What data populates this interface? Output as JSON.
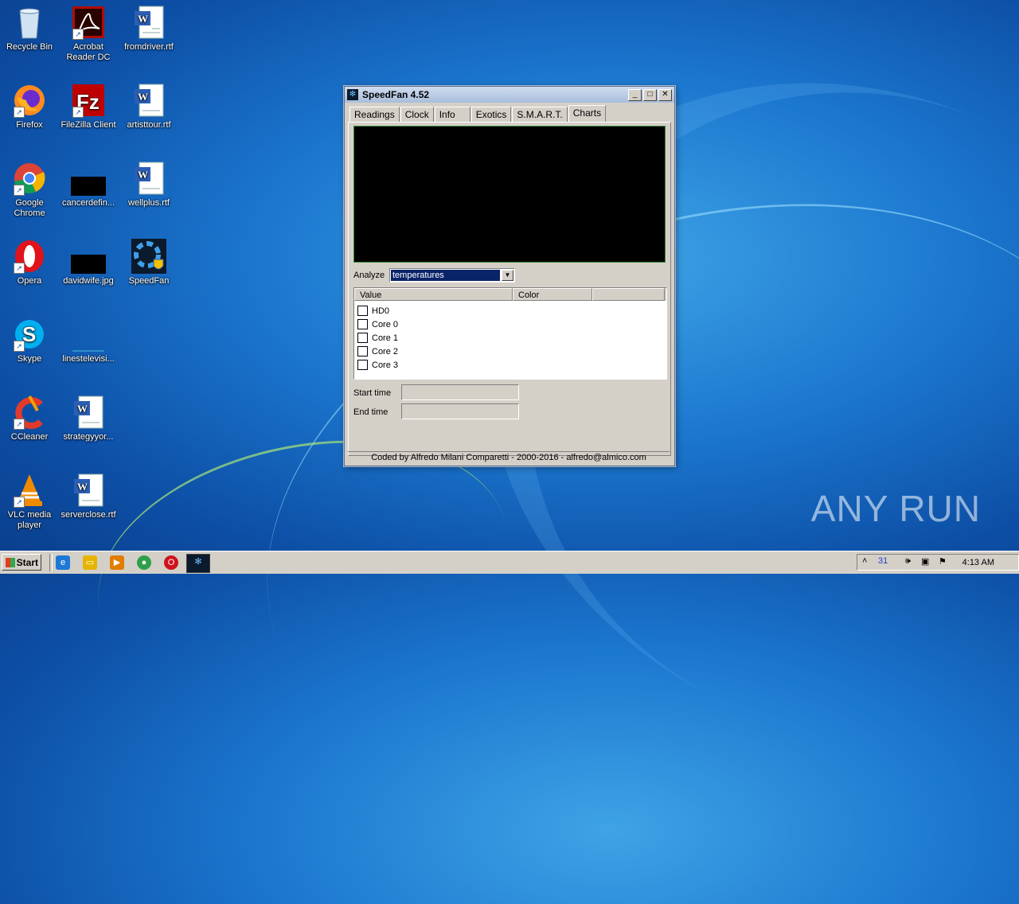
{
  "desktop": {
    "icons": [
      {
        "label": "Recycle Bin",
        "icon": "recycle-bin-icon"
      },
      {
        "label": "Acrobat Reader DC",
        "icon": "acrobat-icon"
      },
      {
        "label": "fromdriver.rtf",
        "icon": "word-document-icon"
      },
      {
        "label": "Firefox",
        "icon": "firefox-icon"
      },
      {
        "label": "FileZilla Client",
        "icon": "filezilla-icon"
      },
      {
        "label": "artisttour.rtf",
        "icon": "word-document-icon"
      },
      {
        "label": "Google Chrome",
        "icon": "chrome-icon"
      },
      {
        "label": "cancerdefin...",
        "icon": "black-thumbnail-icon"
      },
      {
        "label": "wellplus.rtf",
        "icon": "word-document-icon"
      },
      {
        "label": "Opera",
        "icon": "opera-icon"
      },
      {
        "label": "davidwife.jpg",
        "icon": "black-thumbnail-icon"
      },
      {
        "label": "SpeedFan",
        "icon": "speedfan-icon"
      },
      {
        "label": "Skype",
        "icon": "skype-icon"
      },
      {
        "label": "linestelevisi...",
        "icon": "blank-thumbnail-icon"
      },
      {
        "label": "CCleaner",
        "icon": "ccleaner-icon"
      },
      {
        "label": "strategyyor...",
        "icon": "word-document-icon"
      },
      {
        "label": "VLC media player",
        "icon": "vlc-icon"
      },
      {
        "label": "serverclose.rtf",
        "icon": "word-document-icon"
      }
    ]
  },
  "window": {
    "title": "SpeedFan 4.52",
    "tabs": [
      "Readings",
      "Clock",
      "Info",
      "Exotics",
      "S.M.A.R.T.",
      "Charts"
    ],
    "active_tab": "Charts",
    "analyze_label": "Analyze",
    "analyze_value": "temperatures",
    "list_headers": [
      "Value",
      "Color",
      ""
    ],
    "list_items": [
      "HD0",
      "Core 0",
      "Core 1",
      "Core 2",
      "Core 3"
    ],
    "start_time_label": "Start time",
    "end_time_label": "End time",
    "footer": "Coded by Alfredo Milani Comparetti - 2000-2016 - alfredo@almico.com"
  },
  "watermark": "ANY RUN",
  "taskbar": {
    "start_label": "Start",
    "clock": "4:13 AM",
    "tray_badge": "31"
  }
}
